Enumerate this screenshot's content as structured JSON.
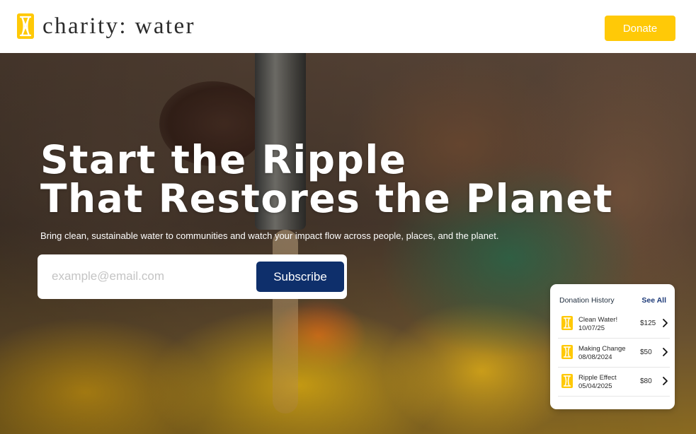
{
  "brand": {
    "name": "charity: water",
    "logo_icon": "jerrycan-icon",
    "accent_color": "#FFC907",
    "navy_color": "#0E2F6B"
  },
  "header": {
    "donate_label": "Donate"
  },
  "hero": {
    "headline_line1": "Start the Ripple",
    "headline_line2": "That Restores the Planet",
    "subtext": "Bring clean, sustainable water to communities and watch your impact flow across people, places, and the planet.",
    "email_placeholder": "example@email.com",
    "subscribe_label": "Subscribe"
  },
  "donation_history": {
    "title": "Donation History",
    "see_all_label": "See All",
    "items": [
      {
        "name": "Clean Water!",
        "date": "10/07/25",
        "amount": "$125",
        "icon": "jerrycan-icon"
      },
      {
        "name": "Making Change",
        "date": "08/08/2024",
        "amount": "$50",
        "icon": "jerrycan-icon"
      },
      {
        "name": "Ripple Effect",
        "date": "05/04/2025",
        "amount": "$80",
        "icon": "jerrycan-icon"
      }
    ]
  }
}
